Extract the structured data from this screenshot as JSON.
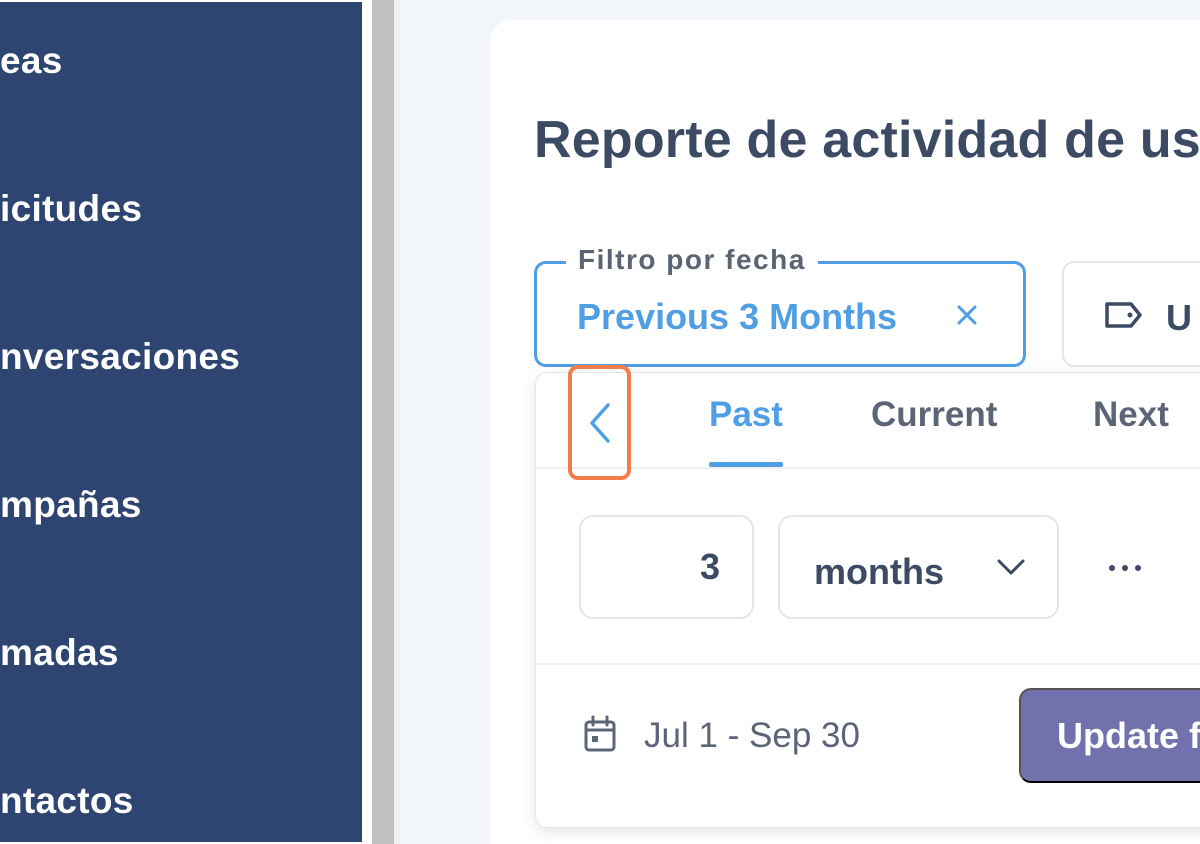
{
  "sidebar": {
    "items": [
      {
        "label": "eas"
      },
      {
        "label": "icitudes"
      },
      {
        "label": "nversaciones"
      },
      {
        "label": "mpañas"
      },
      {
        "label": "madas"
      },
      {
        "label": "ntactos"
      }
    ]
  },
  "main": {
    "title": "Reporte de actividad de us"
  },
  "date_filter": {
    "legend": "Filtro por fecha",
    "value": "Previous 3 Months",
    "clear_icon": "close-icon"
  },
  "second_filter": {
    "icon": "tag-icon",
    "label": "U"
  },
  "popover": {
    "back_icon": "chevron-left-icon",
    "tabs": [
      {
        "label": "Past",
        "active": true
      },
      {
        "label": "Current",
        "active": false
      },
      {
        "label": "Next",
        "active": false
      }
    ],
    "amount": "3",
    "unit": "months",
    "more_icon": "ellipsis-icon",
    "range_icon": "calendar-icon",
    "range": "Jul 1 - Sep 30",
    "update_label": "Update f"
  },
  "colors": {
    "sidebar_bg": "#2e4571",
    "accent": "#509ee3",
    "primary_button": "#7172ad",
    "highlight": "#f47c49",
    "title_text": "#3c4a63"
  }
}
